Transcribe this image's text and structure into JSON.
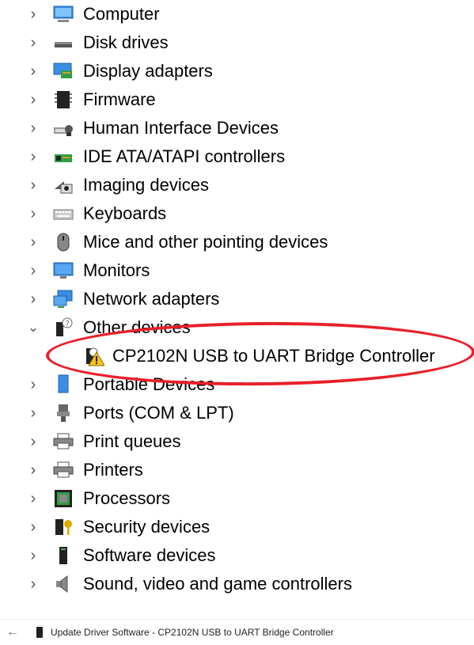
{
  "tree": {
    "items": [
      {
        "label": "Computer",
        "expanded": false,
        "icon": "computer-icon"
      },
      {
        "label": "Disk drives",
        "expanded": false,
        "icon": "disk-drive-icon"
      },
      {
        "label": "Display adapters",
        "expanded": false,
        "icon": "display-adapter-icon"
      },
      {
        "label": "Firmware",
        "expanded": false,
        "icon": "firmware-chip-icon"
      },
      {
        "label": "Human Interface Devices",
        "expanded": false,
        "icon": "hid-icon"
      },
      {
        "label": "IDE ATA/ATAPI controllers",
        "expanded": false,
        "icon": "ide-controller-icon"
      },
      {
        "label": "Imaging devices",
        "expanded": false,
        "icon": "camera-icon"
      },
      {
        "label": "Keyboards",
        "expanded": false,
        "icon": "keyboard-icon"
      },
      {
        "label": "Mice and other pointing devices",
        "expanded": false,
        "icon": "mouse-icon"
      },
      {
        "label": "Monitors",
        "expanded": false,
        "icon": "monitor-icon"
      },
      {
        "label": "Network adapters",
        "expanded": false,
        "icon": "network-adapter-icon"
      },
      {
        "label": "Other devices",
        "expanded": true,
        "icon": "unknown-device-icon"
      },
      {
        "label": "Portable Devices",
        "expanded": false,
        "icon": "portable-device-icon"
      },
      {
        "label": "Ports (COM & LPT)",
        "expanded": false,
        "icon": "port-icon"
      },
      {
        "label": "Print queues",
        "expanded": false,
        "icon": "printer-icon"
      },
      {
        "label": "Printers",
        "expanded": false,
        "icon": "printer-icon"
      },
      {
        "label": "Processors",
        "expanded": false,
        "icon": "processor-icon"
      },
      {
        "label": "Security devices",
        "expanded": false,
        "icon": "security-device-icon"
      },
      {
        "label": "Software devices",
        "expanded": false,
        "icon": "software-device-icon"
      },
      {
        "label": "Sound, video and game controllers",
        "expanded": false,
        "icon": "speaker-icon"
      }
    ],
    "other_devices_child": {
      "label": "CP2102N USB to UART Bridge Controller",
      "icon": "warning-device-icon"
    },
    "expand_glyph": "›",
    "collapse_glyph": "⌄"
  },
  "footer": {
    "back_glyph": "←",
    "title": "Update Driver Software - CP2102N USB to UART Bridge Controller"
  },
  "colors": {
    "highlight_ellipse": "#e8202a"
  }
}
